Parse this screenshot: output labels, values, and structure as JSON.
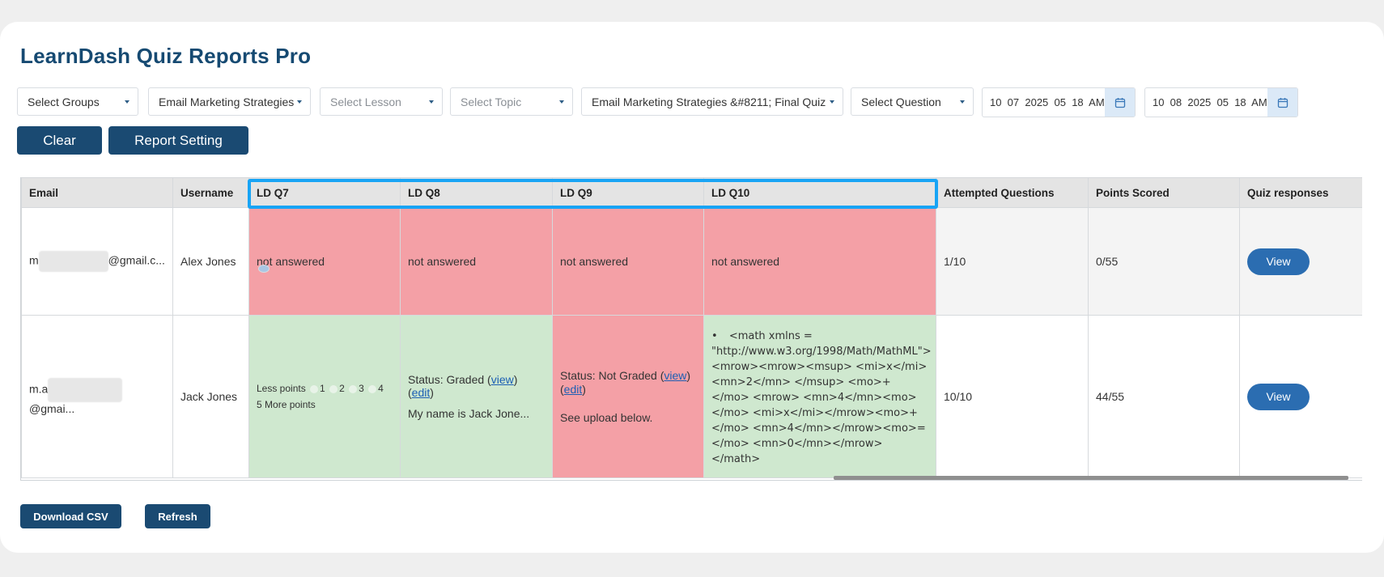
{
  "page": {
    "title": "LearnDash Quiz Reports Pro"
  },
  "filters": {
    "groups": "Select Groups",
    "course": "Email Marketing Strategies",
    "lesson": "Select Lesson",
    "topic": "Select Topic",
    "quiz": "Email Marketing Strategies &#8211; Final Quiz",
    "question": "Select Question",
    "date_from": "10  07  2025  05  18  AM",
    "date_to": "10  08  2025  05  18  AM"
  },
  "buttons": {
    "clear": "Clear",
    "report_setting": "Report Setting",
    "download_csv": "Download CSV",
    "refresh": "Refresh"
  },
  "table": {
    "headers": [
      "Email",
      "Username",
      "LD Q7",
      "LD Q8",
      "LD Q9",
      "LD Q10",
      "Attempted Questions",
      "Points Scored",
      "Quiz responses"
    ],
    "rows": [
      {
        "email_prefix": "m",
        "email_suffix": "@gmail.c...",
        "username": "Alex Jones",
        "q7": "not answered",
        "q8": "not answered",
        "q9": "not answered",
        "q10": "not answered",
        "attempted": "1/10",
        "points": "0/55",
        "view": "View"
      },
      {
        "email_prefix": "m.a",
        "email_suffix": "@gmai...",
        "username": "Jack Jones",
        "q7": {
          "less": "Less points",
          "options": [
            "1",
            "2",
            "3",
            "4"
          ],
          "selected": "5",
          "more": "More points"
        },
        "q8": {
          "status_prefix": "Status: Graded (",
          "view": "view",
          "sep": ") (",
          "edit": "edit",
          "close": ")",
          "answer": "My name is Jack Jone..."
        },
        "q9": {
          "status_prefix": "Status: Not Graded (",
          "view": "view",
          "sep": ") (",
          "edit": "edit",
          "close": ")",
          "note": "See upload below."
        },
        "q10": {
          "bullet": "•",
          "math": "<math xmlns = \"http://www.w3.org/1998/Math/MathML\"> <mrow><mrow><msup> <mi>x</mi> <mn>2</mn> </msup> <mo>+</mo> <mrow> <mn>4</mn><mo></mo> <mi>x</mi></mrow><mo>+</mo> <mn>4</mn></mrow><mo>=</mo> <mn>0</mn></mrow></math>"
        },
        "attempted": "10/10",
        "points": "44/55",
        "view": "View"
      }
    ]
  },
  "colors": {
    "title": "#164a72",
    "button": "#1a4a72",
    "view_button": "#2b6db1",
    "not_answered": "#f4a0a6",
    "answered": "#cfe8cf",
    "highlight": "#18a4f5"
  }
}
